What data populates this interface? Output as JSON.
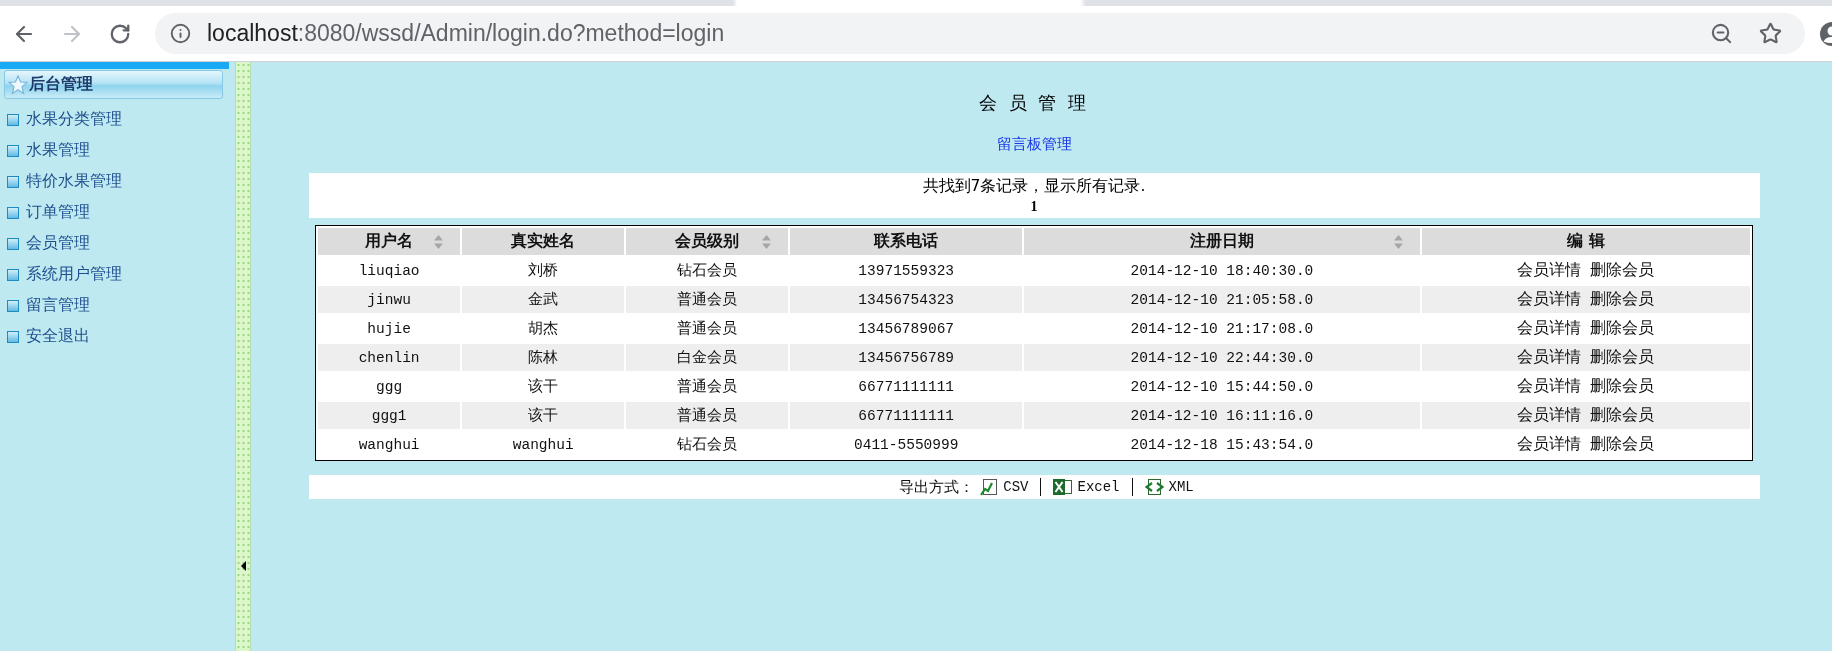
{
  "browser": {
    "nav_buttons": [
      {
        "kind": "back",
        "disabled": false
      },
      {
        "kind": "forward",
        "disabled": true
      },
      {
        "kind": "reload",
        "disabled": false
      }
    ],
    "url": {
      "host": "localhost",
      "rest": ":8080/wssd/Admin/login.do?method=login"
    }
  },
  "sidebar": {
    "title": "后台管理",
    "items": [
      {
        "label": "水果分类管理"
      },
      {
        "label": "水果管理"
      },
      {
        "label": "特价水果管理"
      },
      {
        "label": "订单管理"
      },
      {
        "label": "会员管理"
      },
      {
        "label": "系统用户管理"
      },
      {
        "label": "留言管理"
      },
      {
        "label": "安全退出"
      }
    ]
  },
  "page": {
    "title": "会 员 管 理",
    "link": "留言板管理"
  },
  "summary": {
    "text": "共找到7条记录，显示所有记录.",
    "pages": [
      {
        "label": "1",
        "selected": true
      }
    ]
  },
  "table": {
    "columns": [
      {
        "label": "用户名",
        "sortable": true
      },
      {
        "label": "真实姓名",
        "sortable": false
      },
      {
        "label": "会员级别",
        "sortable": true
      },
      {
        "label": "联系电话",
        "sortable": false
      },
      {
        "label": "注册日期",
        "sortable": true
      },
      {
        "label": "编 辑",
        "sortable": false
      }
    ],
    "rows": [
      {
        "cells": [
          "liuqiao",
          "刘桥",
          "钻石会员",
          "13971559323",
          "2014-12-10 18:40:30.0"
        ],
        "actions": [
          "会员详情",
          "删除会员"
        ]
      },
      {
        "cells": [
          "jinwu",
          "金武",
          "普通会员",
          "13456754323",
          "2014-12-10 21:05:58.0"
        ],
        "actions": [
          "会员详情",
          "删除会员"
        ]
      },
      {
        "cells": [
          "hujie",
          "胡杰",
          "普通会员",
          "13456789067",
          "2014-12-10 21:17:08.0"
        ],
        "actions": [
          "会员详情",
          "删除会员"
        ]
      },
      {
        "cells": [
          "chenlin",
          "陈林",
          "白金会员",
          "13456756789",
          "2014-12-10 22:44:30.0"
        ],
        "actions": [
          "会员详情",
          "删除会员"
        ]
      },
      {
        "cells": [
          "ggg",
          "该干",
          "普通会员",
          "66771111111",
          "2014-12-10 15:44:50.0"
        ],
        "actions": [
          "会员详情",
          "删除会员"
        ]
      },
      {
        "cells": [
          "ggg1",
          "该干",
          "普通会员",
          "66771111111",
          "2014-12-10 16:11:16.0"
        ],
        "actions": [
          "会员详情",
          "删除会员"
        ]
      },
      {
        "cells": [
          "wanghui",
          "wanghui",
          "钻石会员",
          "0411-5550999",
          "2014-12-18 15:43:54.0"
        ],
        "actions": [
          "会员详情",
          "删除会员"
        ]
      }
    ]
  },
  "export": {
    "label": "导出方式：",
    "formats": [
      {
        "kind": "csv",
        "label": "CSV"
      },
      {
        "kind": "excel",
        "label": "Excel"
      },
      {
        "kind": "xml",
        "label": "XML"
      }
    ]
  }
}
